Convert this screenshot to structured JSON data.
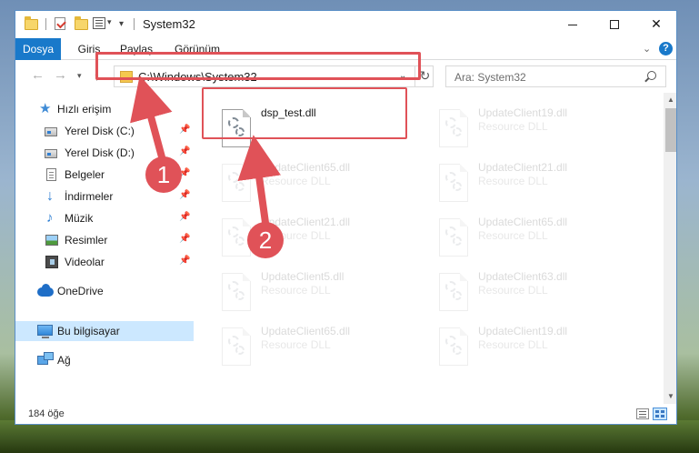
{
  "window": {
    "title": "System32",
    "controls": {
      "minimize": "",
      "maximize": "",
      "close": "✕"
    }
  },
  "ribbon": {
    "tabs": [
      "Dosya",
      "Giriş",
      "Paylaş",
      "Görünüm"
    ],
    "help": "?"
  },
  "navbar": {
    "back": "←",
    "forward": "→",
    "up": "↑",
    "address": "C:\\Windows\\System32",
    "search_placeholder": "Ara: System32"
  },
  "navpane": {
    "quick_access": "Hızlı erişim",
    "pinned": [
      {
        "label": "Yerel Disk (C:)",
        "icon": "drive-icon"
      },
      {
        "label": "Yerel Disk (D:)",
        "icon": "drive-icon"
      },
      {
        "label": "Belgeler",
        "icon": "documents-icon"
      },
      {
        "label": "İndirmeler",
        "icon": "downloads-icon"
      },
      {
        "label": "Müzik",
        "icon": "music-icon"
      },
      {
        "label": "Resimler",
        "icon": "pictures-icon"
      },
      {
        "label": "Videolar",
        "icon": "videos-icon"
      }
    ],
    "onedrive": "OneDrive",
    "this_pc": "Bu bilgisayar",
    "network": "Ağ"
  },
  "files": [
    {
      "name": "dsp_test.dll",
      "type": "",
      "highlighted": true
    },
    {
      "name": "UpdateClient19.dll",
      "type": "Resource DLL"
    },
    {
      "name": "UpdateClient65.dll",
      "type": "Resource DLL"
    },
    {
      "name": "UpdateClient21.dll",
      "type": "Resource DLL"
    },
    {
      "name": "UpdateClient21.dll",
      "type": "Resource DLL"
    },
    {
      "name": "UpdateClient65.dll",
      "type": "Resource DLL"
    },
    {
      "name": "UpdateClient5.dll",
      "type": "Resource DLL"
    },
    {
      "name": "UpdateClient63.dll",
      "type": "Resource DLL"
    },
    {
      "name": "UpdateClient65.dll",
      "type": "Resource DLL"
    },
    {
      "name": "UpdateClient19.dll",
      "type": "Resource DLL"
    }
  ],
  "status": {
    "item_count": "184 öğe"
  },
  "annotations": {
    "step1": "1",
    "step2": "2",
    "color": "#e05258"
  },
  "colors": {
    "accent": "#1979ca",
    "selection": "#cce8ff",
    "highlight": "#e05258"
  }
}
